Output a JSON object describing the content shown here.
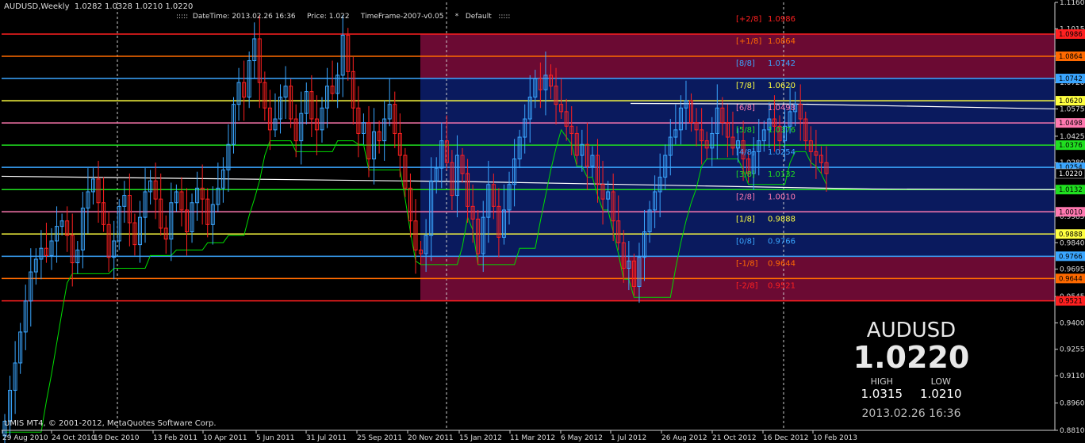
{
  "header": {
    "symbol_ohlc": "AUDUSD,Weekly  1.0282 1.0328 1.0210 1.0220",
    "info": ":::::  DateTime: 2013.02.26 16:36     Price: 1.022     TimeFrame-2007-v0.05     *   Default   :::::"
  },
  "footer": {
    "copyright": "UMIS MT4, © 2001-2012, MetaQuotes Software Corp."
  },
  "panel": {
    "symbol": "AUDUSD",
    "price": "1.0220",
    "high_label": "HIGH",
    "high_value": "1.0315",
    "low_label": "LOW",
    "low_value": "1.0210",
    "datetime": "2013.02.26 16:36"
  },
  "chart_data": {
    "type": "candlestick",
    "symbol": "AUDUSD",
    "timeframe": "Weekly",
    "ylim": [
      0.881,
      1.116
    ],
    "y_ticks": [
      1.116,
      1.1015,
      1.0865,
      1.072,
      1.0575,
      1.0425,
      1.028,
      1.0135,
      0.9985,
      0.984,
      0.9695,
      0.9545,
      0.94,
      0.9255,
      0.911,
      0.896,
      0.881
    ],
    "x_labels": [
      "29 Aug 2010",
      "24 Oct 2010",
      "19 Dec 2010",
      "13 Feb 2011",
      "10 Apr 2011",
      "5 Jun 2011",
      "31 Jul 2011",
      "25 Sep 2011",
      "20 Nov 2011",
      "15 Jan 2012",
      "11 Mar 2012",
      "6 May 2012",
      "1 Jul 2012",
      "26 Aug 2012",
      "21 Oct 2012",
      "16 Dec 2012",
      "10 Feb 2013"
    ],
    "current_price": 1.022,
    "murrey_levels": [
      {
        "label": "[+2/8]",
        "value": 1.0986,
        "color": "#ff2020"
      },
      {
        "label": "[+1/8]",
        "value": 1.0864,
        "color": "#ff6a00"
      },
      {
        "label": "[8/8]",
        "value": 1.0742,
        "color": "#3aa6ff"
      },
      {
        "label": "[7/8]",
        "value": 1.062,
        "color": "#ffff40"
      },
      {
        "label": "[6/8]",
        "value": 1.0498,
        "color": "#ff79b0"
      },
      {
        "label": "[5/8]",
        "value": 1.0376,
        "color": "#20e020"
      },
      {
        "label": "[4/8]",
        "value": 1.0254,
        "color": "#3aa6ff"
      },
      {
        "label": "[3/8]",
        "value": 1.0132,
        "color": "#20e020"
      },
      {
        "label": "[2/8]",
        "value": 1.001,
        "color": "#ff79b0"
      },
      {
        "label": "[1/8]",
        "value": 0.9888,
        "color": "#ffff40"
      },
      {
        "label": "[0/8]",
        "value": 0.9766,
        "color": "#3aa6ff"
      },
      {
        "label": "[-1/8]",
        "value": 0.9644,
        "color": "#ff6a00"
      },
      {
        "label": "[-2/8]",
        "value": 0.9521,
        "color": "#ff2020"
      }
    ],
    "level_value_labels": [
      "1.0986",
      "1.0864",
      "1.0742",
      "1.0620",
      "1.0498",
      "1.0376",
      "1.0254",
      "1.0132",
      "1.0010",
      "0.9888",
      "0.9766",
      "0.9644",
      "0.9521"
    ],
    "colors": {
      "bull": "#3aa6ff",
      "bear": "#ff2020",
      "zone_extreme": "#6b0a33",
      "zone_normal": "#0a1a5e",
      "trail": "#00dd00"
    },
    "closes": [
      0.886,
      0.903,
      0.918,
      0.935,
      0.952,
      0.968,
      0.975,
      0.981,
      0.977,
      0.985,
      0.993,
      0.996,
      0.988,
      0.973,
      0.98,
      1.003,
      1.012,
      1.019,
      1.006,
      0.994,
      0.976,
      0.985,
      1.004,
      1.01,
      0.995,
      0.983,
      0.998,
      1.012,
      1.018,
      1.008,
      0.992,
      0.986,
      1.006,
      1.012,
      1.002,
      0.99,
      1.006,
      1.014,
      1.008,
      0.994,
      1.005,
      1.014,
      1.024,
      1.038,
      1.06,
      1.072,
      1.064,
      1.084,
      1.096,
      1.072,
      1.058,
      1.046,
      1.052,
      1.064,
      1.07,
      1.052,
      1.04,
      1.055,
      1.067,
      1.052,
      1.046,
      1.058,
      1.07,
      1.066,
      1.076,
      1.098,
      1.078,
      1.058,
      1.044,
      1.05,
      1.03,
      1.045,
      1.04,
      1.052,
      1.06,
      1.044,
      1.032,
      1.014,
      0.996,
      0.98,
      0.978,
      0.988,
      1.018,
      1.025,
      1.04,
      1.028,
      1.01,
      1.032,
      1.022,
      1.004,
      0.997,
      0.978,
      0.998,
      1.016,
      1.004,
      0.987,
      1.002,
      1.016,
      1.03,
      1.042,
      1.052,
      1.064,
      1.074,
      1.068,
      1.076,
      1.07,
      1.06,
      1.056,
      1.048,
      1.044,
      1.032,
      1.038,
      1.026,
      1.032,
      1.016,
      1.008,
      1.012,
      0.996,
      0.984,
      0.97,
      0.974,
      0.96,
      0.976,
      0.99,
      1.002,
      1.012,
      1.02,
      1.032,
      1.042,
      1.046,
      1.058,
      1.062,
      1.05,
      1.046,
      1.04,
      1.036,
      1.044,
      1.058,
      1.05,
      1.042,
      1.036,
      1.04,
      1.03,
      1.022,
      1.034,
      1.04,
      1.046,
      1.052,
      1.048,
      1.04,
      1.048,
      1.056,
      1.06,
      1.052,
      1.04,
      1.034,
      1.032,
      1.028,
      1.022
    ]
  }
}
